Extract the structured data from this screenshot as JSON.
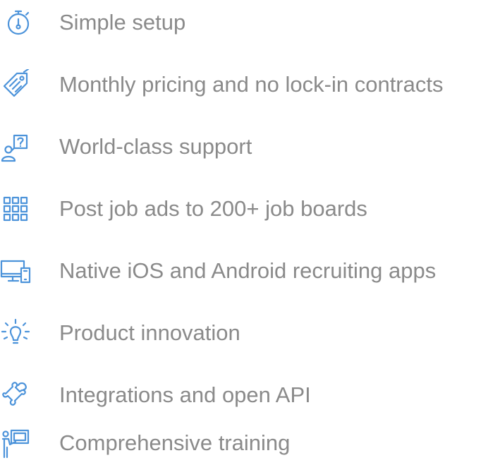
{
  "features": [
    {
      "icon": "stopwatch-icon",
      "label": "Simple setup"
    },
    {
      "icon": "price-tag-icon",
      "label": "Monthly pricing and no lock-in contracts"
    },
    {
      "icon": "support-person-icon",
      "label": "World-class support"
    },
    {
      "icon": "grid-icon",
      "label": "Post job ads to 200+ job boards"
    },
    {
      "icon": "devices-icon",
      "label": "Native iOS and Android recruiting apps"
    },
    {
      "icon": "lightbulb-icon",
      "label": "Product innovation"
    },
    {
      "icon": "puzzle-piece-icon",
      "label": "Integrations and open API"
    },
    {
      "icon": "presentation-icon",
      "label": "Comprehensive training"
    }
  ],
  "colors": {
    "icon": "#4c93da",
    "text": "#8a8a8a",
    "background": "#ffffff"
  }
}
